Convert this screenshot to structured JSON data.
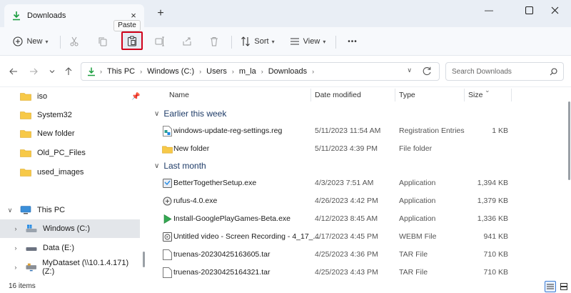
{
  "window": {
    "tab_title": "Downloads",
    "tab_close": "×",
    "new_tab": "+",
    "minimize": "—",
    "maximize": "□",
    "close": "✕"
  },
  "toolbar": {
    "new_label": "New",
    "sort_label": "Sort",
    "view_label": "View",
    "more_label": "•••",
    "tooltip": "Paste"
  },
  "address": {
    "crumbs": [
      "This PC",
      "Windows (C:)",
      "Users",
      "m_la",
      "Downloads"
    ],
    "search_placeholder": "Search Downloads"
  },
  "navpane": {
    "pinned": [
      {
        "label": "iso"
      },
      {
        "label": "System32"
      },
      {
        "label": "New folder"
      },
      {
        "label": "Old_PC_Files"
      },
      {
        "label": "used_images"
      }
    ],
    "this_pc": "This PC",
    "drives": [
      {
        "label": "Windows (C:)"
      },
      {
        "label": "Data (E:)"
      },
      {
        "label": "MyDataset (\\\\10.1.4.171) (Z:)"
      }
    ]
  },
  "columns": {
    "name": "Name",
    "date": "Date modified",
    "type": "Type",
    "size": "Size"
  },
  "groups": [
    {
      "label": "Earlier this week",
      "files": [
        {
          "name": "windows-update-reg-settings.reg",
          "date": "5/11/2023 11:54 AM",
          "type": "Registration Entries",
          "size": "1 KB",
          "icon": "reg-file-icon"
        },
        {
          "name": "New folder",
          "date": "5/11/2023 4:39 PM",
          "type": "File folder",
          "size": "",
          "icon": "folder-icon"
        }
      ]
    },
    {
      "label": "Last month",
      "files": [
        {
          "name": "BetterTogetherSetup.exe",
          "date": "4/3/2023 7:51 AM",
          "type": "Application",
          "size": "1,394 KB",
          "icon": "exe-file-icon"
        },
        {
          "name": "rufus-4.0.exe",
          "date": "4/26/2023 4:42 PM",
          "type": "Application",
          "size": "1,379 KB",
          "icon": "exe-file-icon"
        },
        {
          "name": "Install-GooglePlayGames-Beta.exe",
          "date": "4/12/2023 8:45 AM",
          "type": "Application",
          "size": "1,336 KB",
          "icon": "exe-file-icon"
        },
        {
          "name": "Untitled video - Screen Recording - 4_17_...",
          "date": "4/17/2023 4:45 PM",
          "type": "WEBM File",
          "size": "941 KB",
          "icon": "video-file-icon"
        },
        {
          "name": "truenas-20230425163605.tar",
          "date": "4/25/2023 4:36 PM",
          "type": "TAR File",
          "size": "710 KB",
          "icon": "file-icon"
        },
        {
          "name": "truenas-20230425164321.tar",
          "date": "4/25/2023 4:43 PM",
          "type": "TAR File",
          "size": "710 KB",
          "icon": "file-icon"
        }
      ]
    }
  ],
  "status": {
    "item_count": "16 items"
  }
}
